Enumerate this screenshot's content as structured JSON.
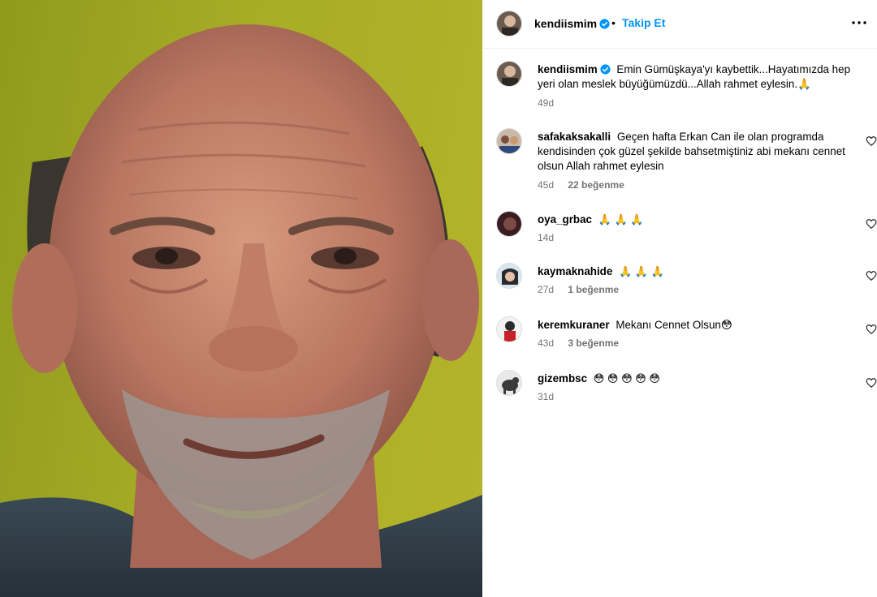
{
  "post": {
    "author": "kendiismim",
    "follow_label": "Takip Et",
    "caption": "Emin Gümüşkaya'yı kaybettik...Hayatımızda hep yeri olan meslek büyüğümüzdü...Allah rahmet eylesin.🙏",
    "caption_time": "49d"
  },
  "comments": [
    {
      "user": "safakaksakalli",
      "text": "Geçen hafta Erkan Can ile olan programda kendisinden çok güzel şekilde bahsetmiştiniz abi mekanı cennet olsun Allah rahmet eylesin",
      "time": "45d",
      "likes": "22 beğenme"
    },
    {
      "user": "oya_grbac",
      "text": "🙏 🙏 🙏",
      "time": "14d",
      "likes": ""
    },
    {
      "user": "kaymaknahide",
      "text": "🙏 🙏 🙏",
      "time": "27d",
      "likes": "1 beğenme"
    },
    {
      "user": "keremkuraner",
      "text": "Mekanı Cennet Olsun😳",
      "time": "43d",
      "likes": "3 beğenme"
    },
    {
      "user": "gizembsc",
      "text": "😳 😳 😳 😳 😳",
      "time": "31d",
      "likes": ""
    }
  ],
  "icons": {
    "verified": "verified-badge-icon",
    "more": "more-options-icon",
    "heart": "heart-outline-icon"
  },
  "colors": {
    "link": "#0095f6",
    "verified": "#0095f6",
    "meta": "#737373",
    "photo_background": "#a7ad26"
  }
}
